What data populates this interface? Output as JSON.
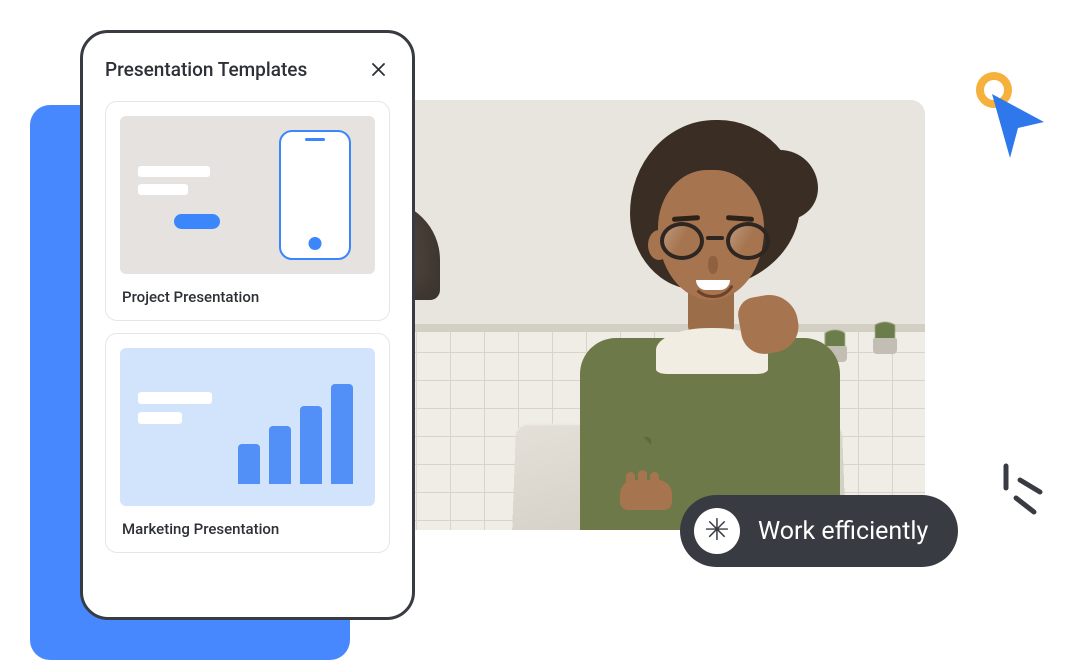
{
  "panel": {
    "title": "Presentation Templates",
    "templates": [
      {
        "label": "Project Presentation"
      },
      {
        "label": "Marketing Presentation"
      }
    ]
  },
  "badge": {
    "text": "Work efficiently",
    "icon": "✳"
  }
}
